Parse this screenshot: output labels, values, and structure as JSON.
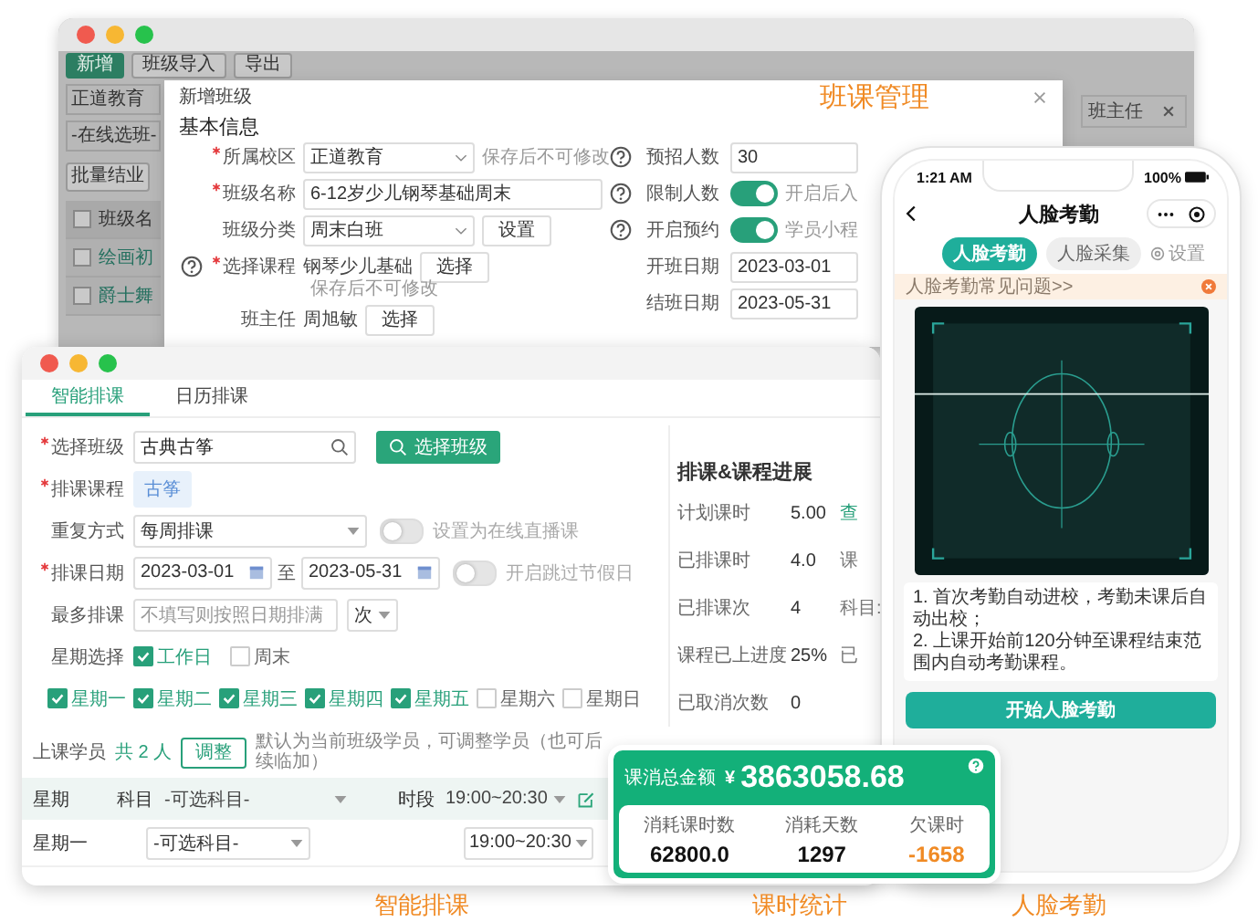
{
  "back_window": {
    "toolbar": [
      {
        "label": "新增",
        "kind": "primary"
      },
      {
        "label": "班级导入",
        "kind": "default"
      },
      {
        "label": "导出",
        "kind": "default"
      }
    ],
    "filters": [
      {
        "value": "正道教育"
      },
      {
        "value": "-在线选班-"
      }
    ],
    "batch_button": "批量结业",
    "table": {
      "column": "班级名",
      "header_checked": false,
      "rows": [
        {
          "name": "绘画初",
          "checked": false
        },
        {
          "name": "爵士舞",
          "checked": false
        }
      ]
    },
    "chip": "班主任"
  },
  "modal": {
    "title": "新增班级",
    "heading": "班课管理",
    "section": "基本信息",
    "left_fields": [
      {
        "label": "所属校区",
        "required": true,
        "help": false,
        "kind": "select",
        "value": "正道教育",
        "note": "保存后不可修改"
      },
      {
        "label": "班级名称",
        "required": true,
        "help": false,
        "kind": "input",
        "value": "6-12岁少儿钢琴基础周末"
      },
      {
        "label": "班级分类",
        "required": false,
        "help": false,
        "kind": "select",
        "value": "周末白班",
        "button": "设置"
      },
      {
        "label": "选择课程",
        "required": true,
        "help": true,
        "kind": "text",
        "value": "钢琴少儿基础",
        "button": "选择",
        "note": "保存后不可修改"
      },
      {
        "label": "班主任",
        "required": false,
        "help": false,
        "kind": "text",
        "value": "周旭敏",
        "button": "选择"
      }
    ],
    "right_fields": [
      {
        "label": "预招人数",
        "help": true,
        "kind": "input",
        "value": "30"
      },
      {
        "label": "限制人数",
        "help": true,
        "kind": "toggle",
        "on": true,
        "note": "开启后入"
      },
      {
        "label": "开启预约",
        "help": true,
        "kind": "toggle",
        "on": true,
        "note": "学员小程"
      },
      {
        "label": "开班日期",
        "help": false,
        "kind": "input",
        "value": "2023-03-01"
      },
      {
        "label": "结班日期",
        "help": false,
        "kind": "input",
        "value": "2023-05-31"
      }
    ]
  },
  "scheduler": {
    "tabs": [
      {
        "label": "智能排课",
        "selected": true
      },
      {
        "label": "日历排课",
        "selected": false
      }
    ],
    "form": [
      {
        "kind": "search",
        "label": "选择班级",
        "required": true,
        "value": "古典古筝",
        "button": "选择班级"
      },
      {
        "kind": "tag",
        "label": "排课课程",
        "required": true,
        "value": "古筝"
      },
      {
        "kind": "select",
        "label": "重复方式",
        "required": false,
        "value": "每周排课",
        "toggle": {
          "on": false,
          "label": "设置为在线直播课"
        }
      },
      {
        "kind": "daterange",
        "label": "排课日期",
        "required": true,
        "from": "2023-03-01",
        "sep": "至",
        "to": "2023-05-31",
        "toggle": {
          "on": false,
          "label": "开启跳过节假日"
        }
      },
      {
        "kind": "count",
        "label": "最多排课",
        "required": false,
        "placeholder": "不填写则按照日期排满",
        "unit": "次"
      },
      {
        "kind": "groups",
        "label": "星期选择",
        "required": false,
        "options": [
          {
            "label": "工作日",
            "checked": true
          },
          {
            "label": "周末",
            "checked": false
          }
        ]
      },
      {
        "kind": "days",
        "options": [
          {
            "label": "星期一",
            "checked": true
          },
          {
            "label": "星期二",
            "checked": true
          },
          {
            "label": "星期三",
            "checked": true
          },
          {
            "label": "星期四",
            "checked": true
          },
          {
            "label": "星期五",
            "checked": true
          },
          {
            "label": "星期六",
            "checked": false
          },
          {
            "label": "星期日",
            "checked": false
          }
        ]
      }
    ],
    "students": {
      "label": "上课学员",
      "count": "共 2 人",
      "button": "调整",
      "hint": "默认为当前班级学员，可调整学员（也可后续临加）"
    },
    "table": {
      "header": {
        "day": "星期",
        "subject_label": "科目",
        "subject": "-可选科目-",
        "time_label": "时段",
        "time": "19:00~20:30"
      },
      "rows": [
        {
          "day": "星期一",
          "subject": "-可选科目-",
          "time": "19:00~20:30"
        }
      ]
    },
    "progress": {
      "title": "排课&课程进展",
      "rows": [
        {
          "label": "计划课时",
          "value": "5.00",
          "extra": "查",
          "link": true
        },
        {
          "label": "已排课时",
          "value": "4.0",
          "extra": "课",
          "link": false
        },
        {
          "label": "已排课次",
          "value": "4",
          "extra": "科目:",
          "link": false
        },
        {
          "label": "课程已上进度",
          "value": "25%",
          "extra": "已",
          "link": false
        },
        {
          "label": "已取消次数",
          "value": "0"
        }
      ]
    }
  },
  "phone": {
    "time": "1:21 AM",
    "battery": "100%",
    "title": "人脸考勤",
    "tabs": [
      {
        "label": "人脸考勤",
        "selected": true
      },
      {
        "label": "人脸采集",
        "selected": false
      }
    ],
    "settings": "设置",
    "notice": "人脸考勤常见问题>>",
    "instructions": [
      "1. 首次考勤自动进校，考勤未课后自动出校；",
      "2. 上课开始前120分钟至课程结束范围内自动考勤课程。"
    ],
    "button": "开始人脸考勤"
  },
  "stats": {
    "title": "课消总金额",
    "currency": "¥",
    "amount": "3863058.68",
    "items": [
      {
        "label": "消耗课时数",
        "value": "62800.0",
        "negative": false
      },
      {
        "label": "消耗天数",
        "value": "1297",
        "negative": false
      },
      {
        "label": "欠课时",
        "value": "-1658",
        "negative": true
      }
    ]
  },
  "captions": [
    "智能排课",
    "课时统计",
    "人脸考勤"
  ]
}
